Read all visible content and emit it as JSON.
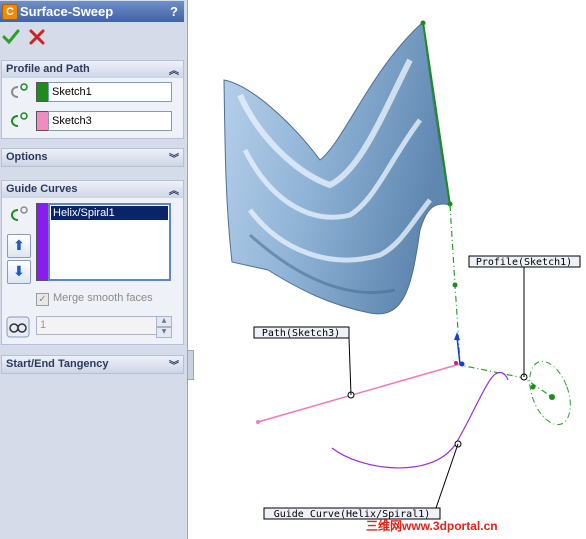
{
  "window": {
    "title": "Surface-Sweep",
    "help_label": "?"
  },
  "actions": {
    "ok_icon": "green-check-icon",
    "cancel_icon": "red-x-icon"
  },
  "profile_and_path": {
    "header": "Profile and Path",
    "profile": {
      "value": "Sketch1",
      "color": "#1c8c1c"
    },
    "path": {
      "value": "Sketch3",
      "color": "#f08cc0"
    }
  },
  "options": {
    "header": "Options"
  },
  "guide_curves": {
    "header": "Guide Curves",
    "items": [
      "Helix/Spiral1"
    ],
    "list_color": "#8a1cf0",
    "merge_label": "Merge smooth faces",
    "merge_checked": true,
    "spin_value": "1"
  },
  "tangency": {
    "header": "Start/End Tangency"
  },
  "callouts": {
    "profile": "Profile(Sketch1)",
    "path": "Path(Sketch3)",
    "guide": "Guide Curve(Helix/Spiral1)"
  },
  "watermark": "三维网www.3dportal.cn",
  "colors": {
    "panel_bg": "#d6dbe9",
    "profile_line": "#2aa02a",
    "path_line": "#f07ab8",
    "guide_line": "#9b2fd4"
  }
}
